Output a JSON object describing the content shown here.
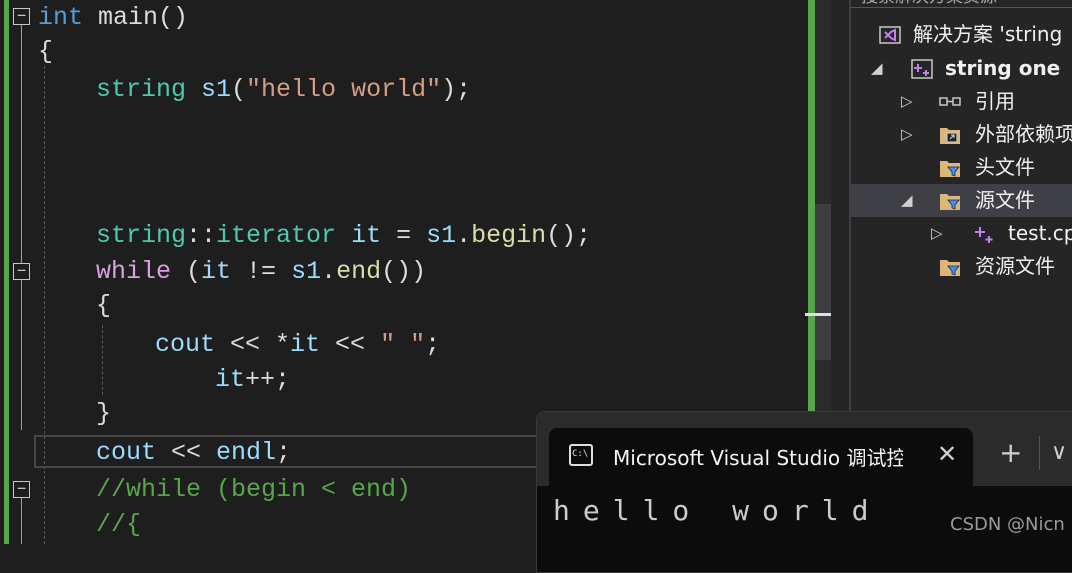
{
  "editor": {
    "lines": {
      "l1": {
        "kw": "int",
        "rest": " main()"
      },
      "l2": "{",
      "l3": {
        "ty": "string",
        "vr": " s1",
        "p1": "(",
        "st": "\"hello world\"",
        "p2": ");"
      },
      "l4": {
        "ty": "string",
        "p1": "::",
        "ty2": "iterator",
        "vr": " it",
        "p2": " = ",
        "vr2": "s1",
        "p3": ".",
        "fn": "begin",
        "p4": "();"
      },
      "l5": {
        "ct": "while",
        "p1": " (",
        "vr": "it",
        "p2": " != ",
        "vr2": "s1",
        "p3": ".",
        "fn": "end",
        "p4": "())"
      },
      "l6": "{",
      "l7": {
        "vr": "cout",
        "p1": " << *",
        "vr2": "it",
        "p2": " << ",
        "st": "\" \"",
        "p3": ";"
      },
      "l8": {
        "vr": "it",
        "p1": "++;"
      },
      "l9": "}",
      "l10": {
        "vr": "cout",
        "p1": " << ",
        "vr2": "endl",
        "p2": ";"
      },
      "l11": "//while (begin < end)",
      "l12": "//{"
    },
    "fold_glyph": "−"
  },
  "explorer": {
    "search_hint": "搜索解决方案资源",
    "items": [
      {
        "label": "解决方案 'string",
        "icon": "solution-icon"
      },
      {
        "label": "string one",
        "icon": "cpp-project-icon"
      },
      {
        "label": "引用",
        "icon": "references-icon"
      },
      {
        "label": "外部依赖项",
        "icon": "external-deps-icon"
      },
      {
        "label": "头文件",
        "icon": "filter-folder-icon"
      },
      {
        "label": "源文件",
        "icon": "filter-folder-icon"
      },
      {
        "label": "test.cpp",
        "icon": "cpp-file-icon"
      },
      {
        "label": "资源文件",
        "icon": "filter-folder-icon"
      }
    ],
    "tri_expanded": "◢",
    "tri_collapsed": "▷"
  },
  "terminal": {
    "tab_title": "Microsoft Visual Studio 调试控制台",
    "icon_text": "C:\\",
    "close_glyph": "✕",
    "new_tab_glyph": "+",
    "dropdown_glyph": "∨",
    "output": "hello world"
  },
  "watermark": "CSDN @Nicn",
  "colors": {
    "keyword": "#569cd6",
    "type": "#4ec9b0",
    "variable": "#9cdcfe",
    "function": "#dcdcaa",
    "string": "#d69d85",
    "comment": "#57a64a",
    "control": "#d8a0df",
    "change_bar": "#57a64a"
  }
}
